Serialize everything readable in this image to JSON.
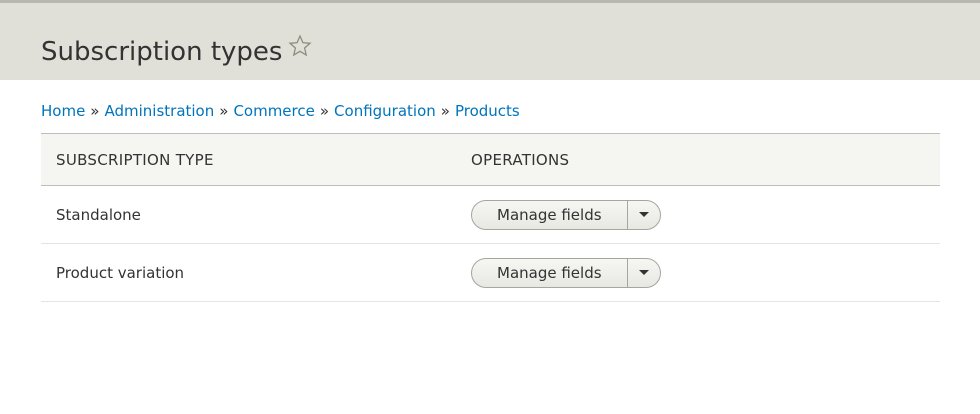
{
  "page": {
    "title": "Subscription types"
  },
  "breadcrumb": [
    {
      "label": "Home"
    },
    {
      "label": "Administration"
    },
    {
      "label": "Commerce"
    },
    {
      "label": "Configuration"
    },
    {
      "label": "Products"
    }
  ],
  "breadcrumb_separator": "»",
  "table": {
    "headers": [
      "SUBSCRIPTION TYPE",
      "OPERATIONS"
    ],
    "rows": [
      {
        "name": "Standalone",
        "operation": "Manage fields"
      },
      {
        "name": "Product variation",
        "operation": "Manage fields"
      }
    ]
  },
  "colors": {
    "link": "#0074bd",
    "header_bg": "#e0e0d8"
  }
}
